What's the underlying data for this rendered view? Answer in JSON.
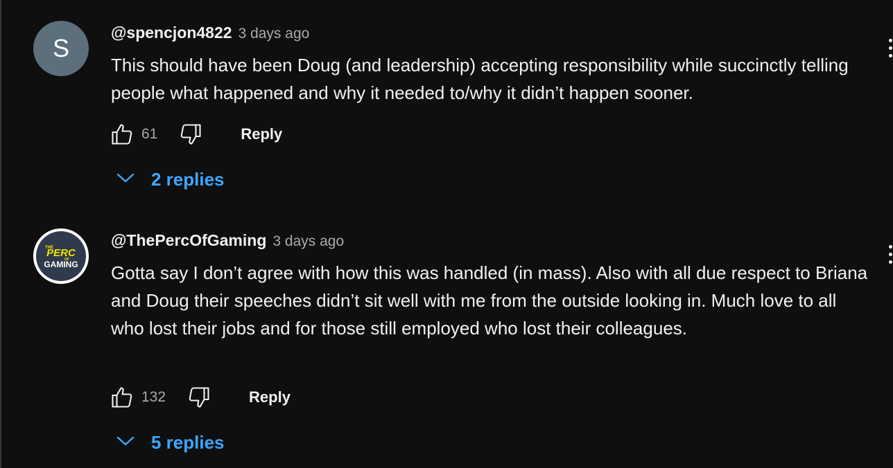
{
  "comments": [
    {
      "avatar_letter": "S",
      "author": "@spencjon4822",
      "time": "3 days ago",
      "text": "This should have been Doug (and leadership) accepting responsibility while succinctly telling people what happened and why it needed to/why it didn’t happen sooner.",
      "likes": "61",
      "reply_label": "Reply",
      "replies_label": "2 replies"
    },
    {
      "avatar_logo_text": [
        "THE",
        "PERC",
        "OF",
        "GAMING"
      ],
      "author": "@ThePercOfGaming",
      "time": "3 days ago",
      "text": "Gotta say I don’t agree with how this was handled (in mass). Also with all due respect to Briana and Doug their speeches didn’t sit well with me from the outside looking in. Much love to all who lost their jobs and for those still employed who lost their colleagues.",
      "likes": "132",
      "reply_label": "Reply",
      "replies_label": "5 replies"
    }
  ],
  "icons": {
    "like": "thumbs-up-icon",
    "dislike": "thumbs-down-icon",
    "expand": "chevron-down-icon",
    "menu": "more-vert-icon"
  },
  "colors": {
    "background": "#0f0f0f",
    "text": "#f1f1f1",
    "secondary_text": "#aaaaaa",
    "link": "#3ea6ff",
    "avatar_s": "#5c6f7b"
  }
}
